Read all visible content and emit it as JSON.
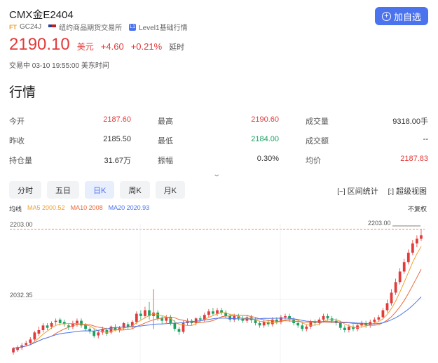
{
  "header": {
    "title": "CMX金E2404",
    "ft": "FT",
    "code": "GC24J",
    "exchange": "纽约商品期货交易所",
    "level": "Level1基础行情",
    "level_icon": "L1",
    "add_label": "加自选",
    "price": "2190.10",
    "unit": "美元",
    "change": "+4.60",
    "change_pct": "+0.21%",
    "delay": "延时",
    "status": "交易中 03-10 19:55:00 美东时间"
  },
  "section_title": "行情",
  "stats": [
    {
      "label": "今开",
      "value": "2187.60"
    },
    {
      "label": "最高",
      "value": "2190.60"
    },
    {
      "label": "成交量",
      "value": "9318.00手"
    },
    {
      "label": "昨收",
      "value": "2185.50"
    },
    {
      "label": "最低",
      "value": "2184.00"
    },
    {
      "label": "成交额",
      "value": "--"
    },
    {
      "label": "持仓量",
      "value": "31.67万"
    },
    {
      "label": "振幅",
      "value": "0.30%"
    },
    {
      "label": "均价",
      "value": "2187.83"
    }
  ],
  "tabs": [
    "分时",
    "五日",
    "日K",
    "周K",
    "月K"
  ],
  "active_tab": "日K",
  "tools": {
    "range_stat": "区间统计",
    "super_view": "超级视图",
    "range_icon": "[~]",
    "view_icon": "[:]"
  },
  "legend": {
    "label": "均线",
    "ma5": "MA5 2000.52",
    "ma10": "MA10 2008",
    "ma20": "MA20 2020.93",
    "fq": "不复权"
  },
  "colors": {
    "up": "#e23b3b",
    "down": "#1aa260",
    "accent": "#4b73ee",
    "ma5": "#f0a030",
    "ma10": "#e86a3a",
    "ma20": "#4b73ee"
  },
  "chart_data": {
    "type": "candlestick",
    "y_labels": [
      "2203.00",
      "2032.35"
    ],
    "marker_label": "2203.00",
    "candles": [
      [
        1990,
        1997,
        1986,
        1999
      ],
      [
        1994,
        1999,
        1991,
        2002
      ],
      [
        1998,
        2002,
        1994,
        2006
      ],
      [
        2003,
        2006,
        2000,
        2010
      ],
      [
        2006,
        2012,
        2003,
        2016
      ],
      [
        2012,
        2024,
        2008,
        2027
      ],
      [
        2022,
        2028,
        2018,
        2034
      ],
      [
        2028,
        2036,
        2024,
        2040
      ],
      [
        2036,
        2032,
        2028,
        2040
      ],
      [
        2034,
        2040,
        2030,
        2043
      ],
      [
        2042,
        2044,
        2036,
        2048
      ],
      [
        2046,
        2040,
        2036,
        2049
      ],
      [
        2042,
        2038,
        2034,
        2046
      ],
      [
        2036,
        2034,
        2028,
        2040
      ],
      [
        2034,
        2040,
        2030,
        2044
      ],
      [
        2038,
        2044,
        2034,
        2048
      ],
      [
        2044,
        2036,
        2032,
        2048
      ],
      [
        2038,
        2030,
        2026,
        2040
      ],
      [
        2030,
        2026,
        2022,
        2033
      ],
      [
        2026,
        2018,
        2015,
        2030
      ],
      [
        2019,
        2024,
        2014,
        2028
      ],
      [
        2024,
        2030,
        2020,
        2034
      ],
      [
        2028,
        2022,
        2018,
        2032
      ],
      [
        2024,
        2034,
        2021,
        2036
      ],
      [
        2032,
        2028,
        2026,
        2038
      ],
      [
        2028,
        2032,
        2024,
        2035
      ],
      [
        2032,
        2040,
        2028,
        2042
      ],
      [
        2038,
        2034,
        2030,
        2042
      ],
      [
        2034,
        2042,
        2031,
        2045
      ],
      [
        2042,
        2056,
        2038,
        2060
      ],
      [
        2056,
        2052,
        2046,
        2062
      ],
      [
        2052,
        2062,
        2048,
        2068
      ],
      [
        2062,
        2052,
        2046,
        2076
      ],
      [
        2052,
        2058,
        2030,
        2098
      ],
      [
        2058,
        2048,
        2044,
        2062
      ],
      [
        2048,
        2044,
        2038,
        2052
      ],
      [
        2044,
        2050,
        2040,
        2054
      ],
      [
        2050,
        2040,
        2036,
        2054
      ],
      [
        2040,
        2030,
        2026,
        2045
      ],
      [
        2030,
        2025,
        2020,
        2034
      ],
      [
        2025,
        2040,
        2022,
        2044
      ],
      [
        2040,
        2044,
        2036,
        2048
      ],
      [
        2044,
        2040,
        2036,
        2047
      ],
      [
        2040,
        2048,
        2036,
        2050
      ],
      [
        2048,
        2046,
        2042,
        2052
      ],
      [
        2046,
        2054,
        2042,
        2058
      ],
      [
        2054,
        2060,
        2050,
        2064
      ],
      [
        2060,
        2056,
        2052,
        2066
      ],
      [
        2056,
        2062,
        2052,
        2066
      ],
      [
        2062,
        2058,
        2054,
        2066
      ],
      [
        2058,
        2052,
        2048,
        2062
      ],
      [
        2052,
        2046,
        2042,
        2056
      ],
      [
        2046,
        2052,
        2042,
        2056
      ],
      [
        2052,
        2048,
        2044,
        2056
      ],
      [
        2048,
        2044,
        2040,
        2052
      ],
      [
        2044,
        2050,
        2040,
        2054
      ],
      [
        2050,
        2045,
        2040,
        2054
      ],
      [
        2045,
        2040,
        2036,
        2049
      ],
      [
        2040,
        2036,
        2032,
        2044
      ],
      [
        2036,
        2042,
        2032,
        2046
      ],
      [
        2042,
        2038,
        2034,
        2046
      ],
      [
        2038,
        2046,
        2034,
        2050
      ],
      [
        2046,
        2042,
        2038,
        2050
      ],
      [
        2042,
        2050,
        2038,
        2054
      ],
      [
        2050,
        2052,
        2046,
        2056
      ],
      [
        2052,
        2046,
        2042,
        2056
      ],
      [
        2046,
        2040,
        2036,
        2050
      ],
      [
        2040,
        2036,
        2032,
        2044
      ],
      [
        2036,
        2030,
        2026,
        2040
      ],
      [
        2030,
        2034,
        2026,
        2038
      ],
      [
        2034,
        2042,
        2030,
        2046
      ],
      [
        2042,
        2040,
        2036,
        2046
      ],
      [
        2040,
        2046,
        2036,
        2050
      ],
      [
        2046,
        2052,
        2042,
        2056
      ],
      [
        2052,
        2048,
        2044,
        2056
      ],
      [
        2048,
        2044,
        2040,
        2052
      ],
      [
        2044,
        2040,
        2036,
        2048
      ],
      [
        2040,
        2032,
        2028,
        2044
      ],
      [
        2032,
        2028,
        2024,
        2036
      ],
      [
        2028,
        2034,
        2024,
        2038
      ],
      [
        2034,
        2030,
        2026,
        2038
      ],
      [
        2030,
        2036,
        2026,
        2040
      ],
      [
        2036,
        2040,
        2032,
        2044
      ],
      [
        2040,
        2036,
        2032,
        2044
      ],
      [
        2036,
        2042,
        2032,
        2046
      ],
      [
        2042,
        2046,
        2038,
        2050
      ],
      [
        2046,
        2050,
        2042,
        2054
      ],
      [
        2050,
        2062,
        2046,
        2066
      ],
      [
        2062,
        2074,
        2058,
        2080
      ],
      [
        2074,
        2092,
        2070,
        2098
      ],
      [
        2092,
        2110,
        2088,
        2116
      ],
      [
        2110,
        2128,
        2106,
        2134
      ],
      [
        2128,
        2144,
        2124,
        2150
      ],
      [
        2144,
        2160,
        2140,
        2166
      ],
      [
        2160,
        2176,
        2156,
        2182
      ],
      [
        2176,
        2184,
        2170,
        2190
      ],
      [
        2184,
        2190,
        2180,
        2200
      ]
    ]
  }
}
